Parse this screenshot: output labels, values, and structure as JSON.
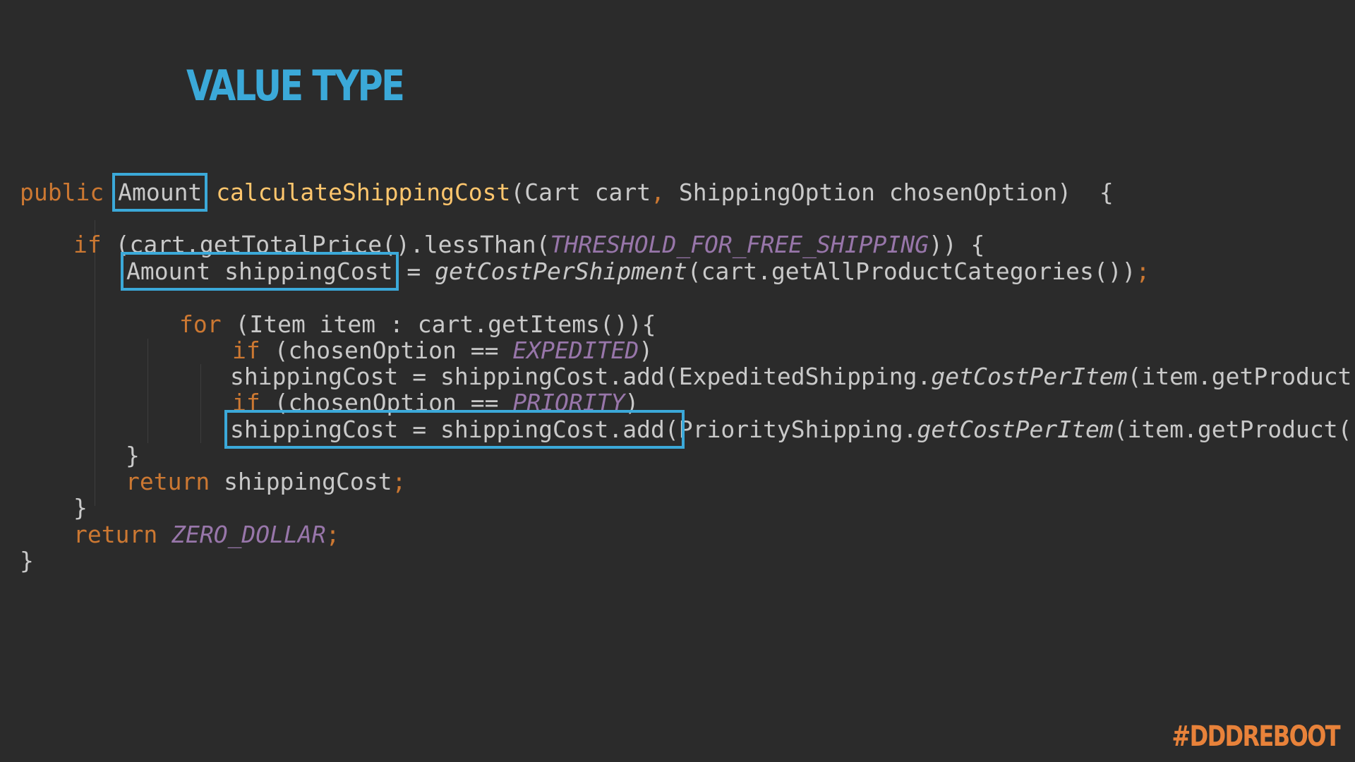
{
  "slide": {
    "title": "VALUE TYPE",
    "hashtag": "#DDDREBOOT"
  },
  "colors": {
    "background": "#2b2b2b",
    "title": "#3ba9d9",
    "highlight_box": "#3ba9d9",
    "hashtag": "#e8823a",
    "keyword": "#cc7832",
    "method_declaration": "#ffc66d",
    "constant": "#9876aa",
    "default_text": "#c9c9c9"
  },
  "code": {
    "l1": {
      "kw_public": "public",
      "type_amount": "Amount",
      "method_name": "calculateShippingCost",
      "params_a": "(Cart cart",
      "comma": ",",
      "params_b": " ShippingOption chosenOption)  {"
    },
    "l2": {
      "kw_if": "if",
      "cond": " (cart.getTotalPrice().lessThan(",
      "const_threshold": "THRESHOLD_FOR_FREE_SHIPPING",
      "cond_end": ")) {"
    },
    "l3": {
      "decl": "Amount shippingCost",
      "assign": " = ",
      "call": "getCostPerShipment",
      "args": "(cart.getAllProductCategories())",
      "semi": ";"
    },
    "l4": {
      "kw_for": "for",
      "loop": " (Item item : cart.getItems()){"
    },
    "l5": {
      "kw_if": "if",
      "cond": " (chosenOption == ",
      "const_expedited": "EXPEDITED",
      "cond_end": ")"
    },
    "l6": {
      "stmt": "shippingCost = shippingCost.add(ExpeditedShipping.",
      "call": "getCostPerItem",
      "args": "(item.getProduct()))",
      "semi": ";"
    },
    "l7": {
      "kw_if": "if",
      "cond": " (chosenOption == ",
      "const_priority": "PRIORITY",
      "cond_end": ")"
    },
    "l8": {
      "stmt_boxed": "shippingCost = shippingCost.add(",
      "stmt_rest": "PriorityShipping.",
      "call": "getCostPerItem",
      "args": "(item.getProduct()))",
      "semi": ";"
    },
    "l9": {
      "brace": "}"
    },
    "l10": {
      "kw_return": "return",
      "value": " shippingCost",
      "semi": ";"
    },
    "l11": {
      "brace": "}"
    },
    "l12": {
      "kw_return": "return",
      "space": " ",
      "const_zero": "ZERO_DOLLAR",
      "semi": ";"
    },
    "l13": {
      "brace": "}"
    }
  }
}
